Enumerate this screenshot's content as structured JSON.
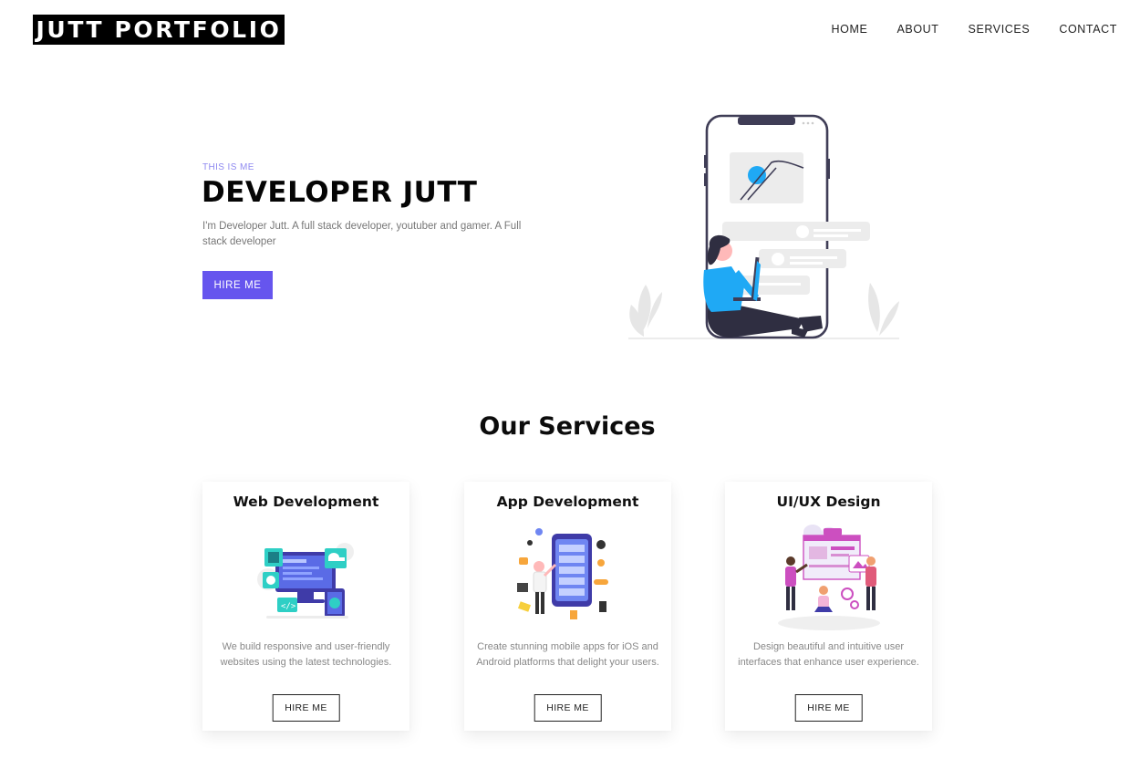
{
  "header": {
    "logo": "JUTT PORTFOLIO",
    "nav": [
      "HOME",
      "ABOUT",
      "SERVICES",
      "CONTACT"
    ]
  },
  "hero": {
    "eyebrow": "THIS IS ME",
    "title": "DEVELOPER JUTT",
    "description": "I'm Developer Jutt. A full stack developer, youtuber and gamer. A Full stack developer",
    "button": "HIRE ME"
  },
  "services": {
    "title": "Our Services",
    "cards": [
      {
        "title": "Web Development",
        "description": "We build responsive and user-friendly websites using the latest technologies.",
        "button": "HIRE ME"
      },
      {
        "title": "App Development",
        "description": "Create stunning mobile apps for iOS and Android platforms that delight your users.",
        "button": "HIRE ME"
      },
      {
        "title": "UI/UX Design",
        "description": "Design beautiful and intuitive user interfaces that enhance user experience.",
        "button": "HIRE ME"
      }
    ]
  },
  "colors": {
    "accent": "#6655ee",
    "eyebrow": "#8f8af0",
    "illustration_blue": "#1fa9f5"
  }
}
